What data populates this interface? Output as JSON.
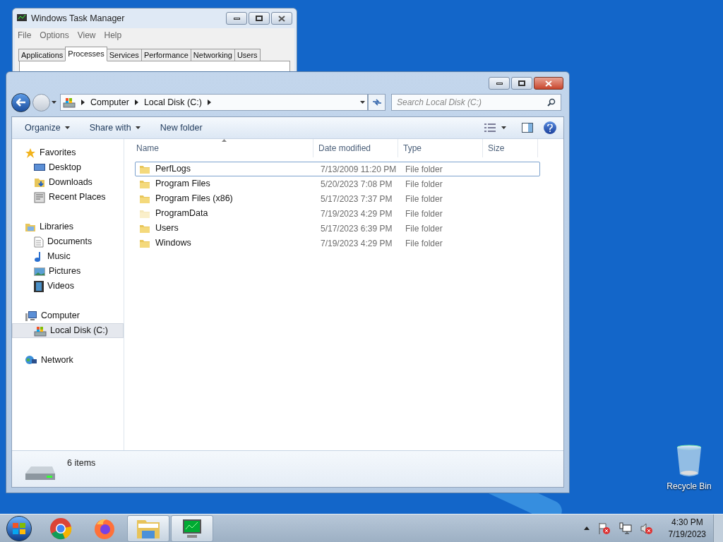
{
  "task_manager": {
    "title": "Windows Task Manager",
    "menu": [
      "File",
      "Options",
      "View",
      "Help"
    ],
    "tabs": [
      {
        "label": "Applications",
        "selected": false
      },
      {
        "label": "Processes",
        "selected": true
      },
      {
        "label": "Services",
        "selected": false
      },
      {
        "label": "Performance",
        "selected": false
      },
      {
        "label": "Networking",
        "selected": false
      },
      {
        "label": "Users",
        "selected": false
      }
    ]
  },
  "explorer": {
    "breadcrumb": [
      "Computer",
      "Local Disk (C:)"
    ],
    "search": {
      "placeholder": "Search Local Disk (C:)"
    },
    "toolbar": [
      {
        "label": "Organize",
        "dropdown": true
      },
      {
        "label": "Share with",
        "dropdown": true
      },
      {
        "label": "New folder",
        "dropdown": false
      }
    ],
    "sidebar": [
      {
        "label": "Favorites",
        "kind": "favorites",
        "items": [
          {
            "label": "Desktop",
            "kind": "desktop",
            "selected": false
          },
          {
            "label": "Downloads",
            "kind": "downloads",
            "selected": false
          },
          {
            "label": "Recent Places",
            "kind": "recent",
            "selected": false
          }
        ]
      },
      {
        "label": "Libraries",
        "kind": "libraries",
        "items": [
          {
            "label": "Documents",
            "kind": "documents",
            "selected": false
          },
          {
            "label": "Music",
            "kind": "music",
            "selected": false
          },
          {
            "label": "Pictures",
            "kind": "pictures",
            "selected": false
          },
          {
            "label": "Videos",
            "kind": "videos",
            "selected": false
          }
        ]
      },
      {
        "label": "Computer",
        "kind": "computer",
        "items": [
          {
            "label": "Local Disk (C:)",
            "kind": "disk",
            "selected": true
          }
        ]
      },
      {
        "label": "Network",
        "kind": "network"
      }
    ],
    "columns": [
      "Name",
      "Date modified",
      "Type",
      "Size"
    ],
    "rows": [
      {
        "name": "PerfLogs",
        "date": "7/13/2009 11:20 PM",
        "type": "File folder",
        "hidden": false,
        "selected": true
      },
      {
        "name": "Program Files",
        "date": "5/20/2023 7:08 PM",
        "type": "File folder",
        "hidden": false,
        "selected": false
      },
      {
        "name": "Program Files (x86)",
        "date": "5/17/2023 7:37 PM",
        "type": "File folder",
        "hidden": false,
        "selected": false
      },
      {
        "name": "ProgramData",
        "date": "7/19/2023 4:29 PM",
        "type": "File folder",
        "hidden": true,
        "selected": false
      },
      {
        "name": "Users",
        "date": "5/17/2023 6:39 PM",
        "type": "File folder",
        "hidden": false,
        "selected": false
      },
      {
        "name": "Windows",
        "date": "7/19/2023 4:29 PM",
        "type": "File folder",
        "hidden": false,
        "selected": false
      }
    ],
    "status": "6 items"
  },
  "desktop_icons": [
    {
      "label": "Recycle Bin"
    }
  ],
  "taskbar": {
    "apps": [
      {
        "kind": "chrome",
        "open": false
      },
      {
        "kind": "firefox",
        "open": false
      },
      {
        "kind": "explorer",
        "open": true
      },
      {
        "kind": "taskmgr",
        "open": true
      }
    ],
    "clock": {
      "time": "4:30 PM",
      "date": "7/19/2023"
    }
  }
}
